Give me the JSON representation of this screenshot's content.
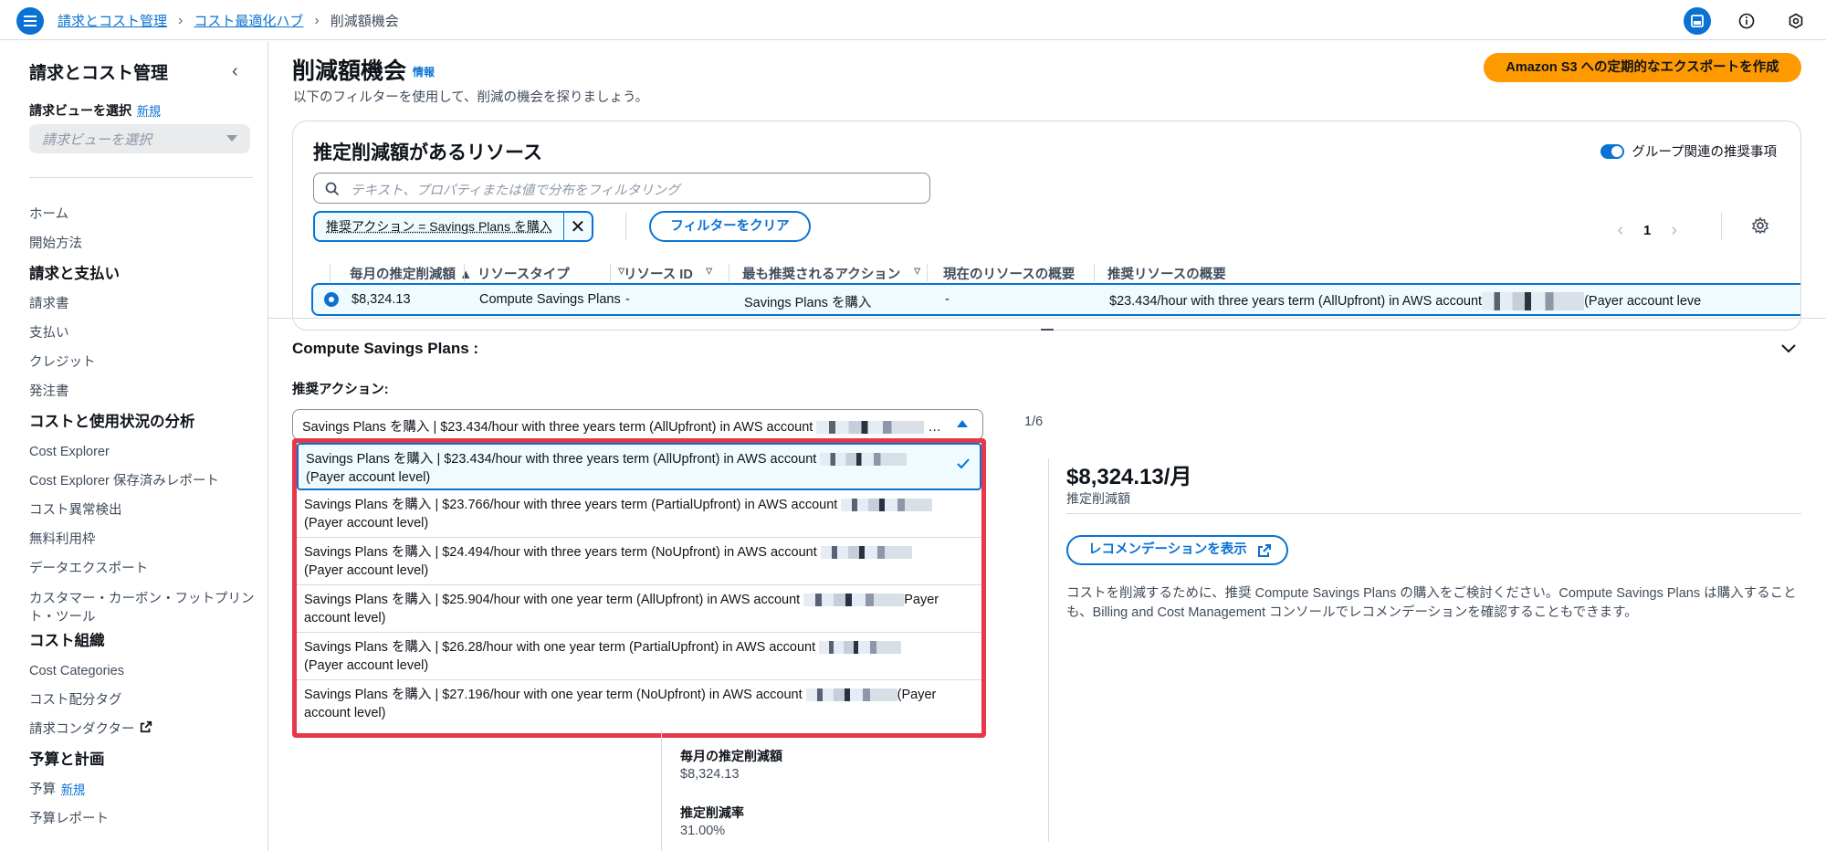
{
  "breadcrumb": [
    "請求とコスト管理",
    "コスト最適化ハブ",
    "削減額機会"
  ],
  "sidebar": {
    "title": "請求とコスト管理",
    "view_label": "請求ビューを選択",
    "view_new": "新規",
    "view_placeholder": "請求ビューを選択",
    "items": [
      {
        "type": "item",
        "label": "ホーム"
      },
      {
        "type": "item",
        "label": "開始方法"
      },
      {
        "type": "head",
        "label": "請求と支払い"
      },
      {
        "type": "item",
        "label": "請求書"
      },
      {
        "type": "item",
        "label": "支払い"
      },
      {
        "type": "item",
        "label": "クレジット"
      },
      {
        "type": "item",
        "label": "発注書"
      },
      {
        "type": "head",
        "label": "コストと使用状況の分析"
      },
      {
        "type": "item",
        "label": "Cost Explorer"
      },
      {
        "type": "item",
        "label": "Cost Explorer 保存済みレポート"
      },
      {
        "type": "item",
        "label": "コスト異常検出"
      },
      {
        "type": "item",
        "label": "無料利用枠"
      },
      {
        "type": "item",
        "label": "データエクスポート"
      },
      {
        "type": "wrap",
        "label": "カスタマー・カーボン・フットプリント・ツール"
      },
      {
        "type": "head",
        "label": "コスト組織"
      },
      {
        "type": "item",
        "label": "Cost Categories"
      },
      {
        "type": "item",
        "label": "コスト配分タグ"
      },
      {
        "type": "external",
        "label": "請求コンダクター"
      },
      {
        "type": "head",
        "label": "予算と計画"
      },
      {
        "type": "new",
        "label": "予算",
        "badge": "新規"
      },
      {
        "type": "item",
        "label": "予算レポート"
      }
    ]
  },
  "header": {
    "title": "削減額機会",
    "info": "情報",
    "subtitle": "以下のフィルターを使用して、削減の機会を探りましょう。",
    "export_button": "Amazon S3 への定期的なエクスポートを作成"
  },
  "resources": {
    "title": "推定削減額があるリソース",
    "group_toggle": "グループ関連の推奨事項",
    "search_placeholder": "テキスト、プロパティまたは値で分布をフィルタリング",
    "filter_chip": "推奨アクション = Savings Plans を購入",
    "clear_button": "フィルターをクリア",
    "page": "1",
    "columns": [
      "毎月の推定削減額",
      "リソースタイプ",
      "リソース ID",
      "最も推奨されるアクション",
      "現在のリソースの概要",
      "推奨リソースの概要"
    ],
    "row": {
      "savings": "$8,324.13",
      "type": "Compute Savings Plans",
      "id": "-",
      "action": "Savings Plans を購入",
      "current": "-",
      "recommended": "$23.434/hour with three years term (AllUpfront) in AWS account",
      "recommended_tail": "(Payer account leve"
    }
  },
  "details": {
    "title": "Compute Savings Plans :",
    "action_label": "推奨アクション:",
    "selected": "Savings Plans を購入 | $23.434/hour with three years term (AllUpfront) in AWS account",
    "selected_ellipsis": "…",
    "count": "1/6",
    "options": [
      {
        "line1": "Savings Plans を購入 | $23.434/hour with three years term (AllUpfront) in AWS account",
        "line2": "(Payer account level)"
      },
      {
        "line1": "Savings Plans を購入 | $23.766/hour with three years term (PartialUpfront) in AWS account",
        "line2": "(Payer account level)"
      },
      {
        "line1": "Savings Plans を購入 | $24.494/hour with three years term (NoUpfront) in AWS account",
        "line2": "(Payer account level)"
      },
      {
        "line1": "Savings Plans を購入 | $25.904/hour with one year term (AllUpfront) in AWS account",
        "tail": "Payer",
        "line2": "account level)"
      },
      {
        "line1": "Savings Plans を購入 | $26.28/hour with one year term (PartialUpfront) in AWS account",
        "line2": "(Payer account level)"
      },
      {
        "line1": "Savings Plans を購入 | $27.196/hour with one year term (NoUpfront) in AWS account",
        "tail": "(Payer",
        "line2": "account level)"
      }
    ],
    "monthly_savings": "$8,324.13/月",
    "monthly_savings_label": "推定削減額",
    "rec_button": "レコメンデーションを表示",
    "description": "コストを削減するために、推奨 Compute Savings Plans の購入をご検討ください。Compute Savings Plans は購入することも、Billing and Cost Management コンソールでレコメンデーションを確認することもできます。",
    "metric1_label": "毎月の推定削減額",
    "metric1_value": "$8,324.13",
    "metric2_label": "推定削減率",
    "metric2_value": "31.00%"
  }
}
